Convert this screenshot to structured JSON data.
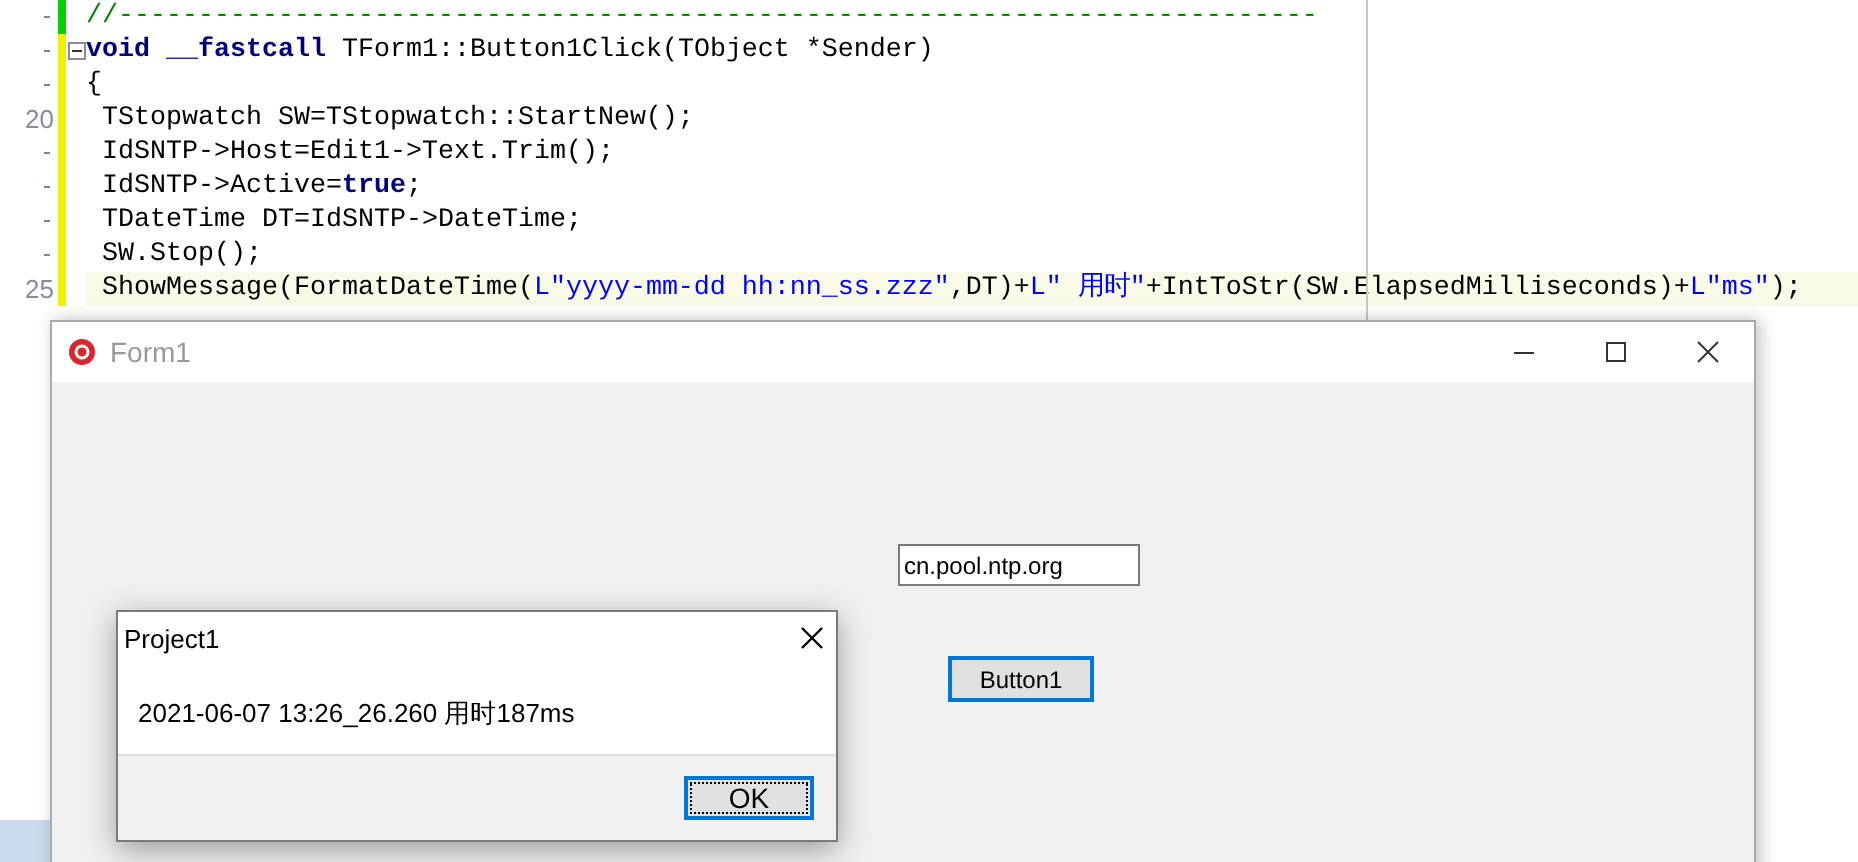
{
  "editor": {
    "lines": [
      {
        "modified": false,
        "fold": false,
        "current": false,
        "tokens": [
          {
            "kind": "comment",
            "text": "//---------------------------------------------------------------------------"
          }
        ]
      },
      {
        "modified": true,
        "fold": true,
        "current": false,
        "tokens": [
          {
            "kind": "keyword",
            "text": "void __fastcall"
          },
          {
            "kind": "plain",
            "text": " TForm1::Button1Click(TObject *Sender)"
          }
        ]
      },
      {
        "modified": true,
        "fold": false,
        "current": false,
        "tokens": [
          {
            "kind": "plain",
            "text": "{"
          }
        ]
      },
      {
        "number": "20",
        "modified": true,
        "fold": false,
        "current": false,
        "tokens": [
          {
            "kind": "plain",
            "text": " TStopwatch SW=TStopwatch::StartNew();"
          }
        ]
      },
      {
        "modified": true,
        "fold": false,
        "current": false,
        "tokens": [
          {
            "kind": "plain",
            "text": " IdSNTP->Host=Edit1->Text.Trim();"
          }
        ]
      },
      {
        "modified": true,
        "fold": false,
        "current": false,
        "tokens": [
          {
            "kind": "plain",
            "text": " IdSNTP->Active="
          },
          {
            "kind": "keyword",
            "text": "true"
          },
          {
            "kind": "plain",
            "text": ";"
          }
        ]
      },
      {
        "modified": true,
        "fold": false,
        "current": false,
        "tokens": [
          {
            "kind": "plain",
            "text": " TDateTime DT=IdSNTP->DateTime;"
          }
        ]
      },
      {
        "modified": true,
        "fold": false,
        "current": false,
        "tokens": [
          {
            "kind": "plain",
            "text": " SW.Stop();"
          }
        ]
      },
      {
        "number": "25",
        "modified": true,
        "fold": false,
        "current": true,
        "tokens": [
          {
            "kind": "plain",
            "text": " ShowMessage(FormatDateTime("
          },
          {
            "kind": "string",
            "text": "L\"yyyy-mm-dd hh:nn_ss.zzz\""
          },
          {
            "kind": "plain",
            "text": ",DT)+"
          },
          {
            "kind": "string",
            "text": "L\" 用时\""
          },
          {
            "kind": "plain",
            "text": "+IntToStr(SW.ElapsedMilliseconds)+"
          },
          {
            "kind": "string",
            "text": "L\"ms\""
          },
          {
            "kind": "plain",
            "text": ");"
          }
        ]
      }
    ]
  },
  "form": {
    "title": "Form1",
    "active": false,
    "host_field": {
      "value": "cn.pool.ntp.org"
    },
    "button": {
      "label": "Button1",
      "focused": true
    }
  },
  "dialog": {
    "title": "Project1",
    "message": "2021-06-07 13:26_26.260 用时187ms",
    "ok_button": {
      "label": "OK",
      "focused": true
    }
  }
}
